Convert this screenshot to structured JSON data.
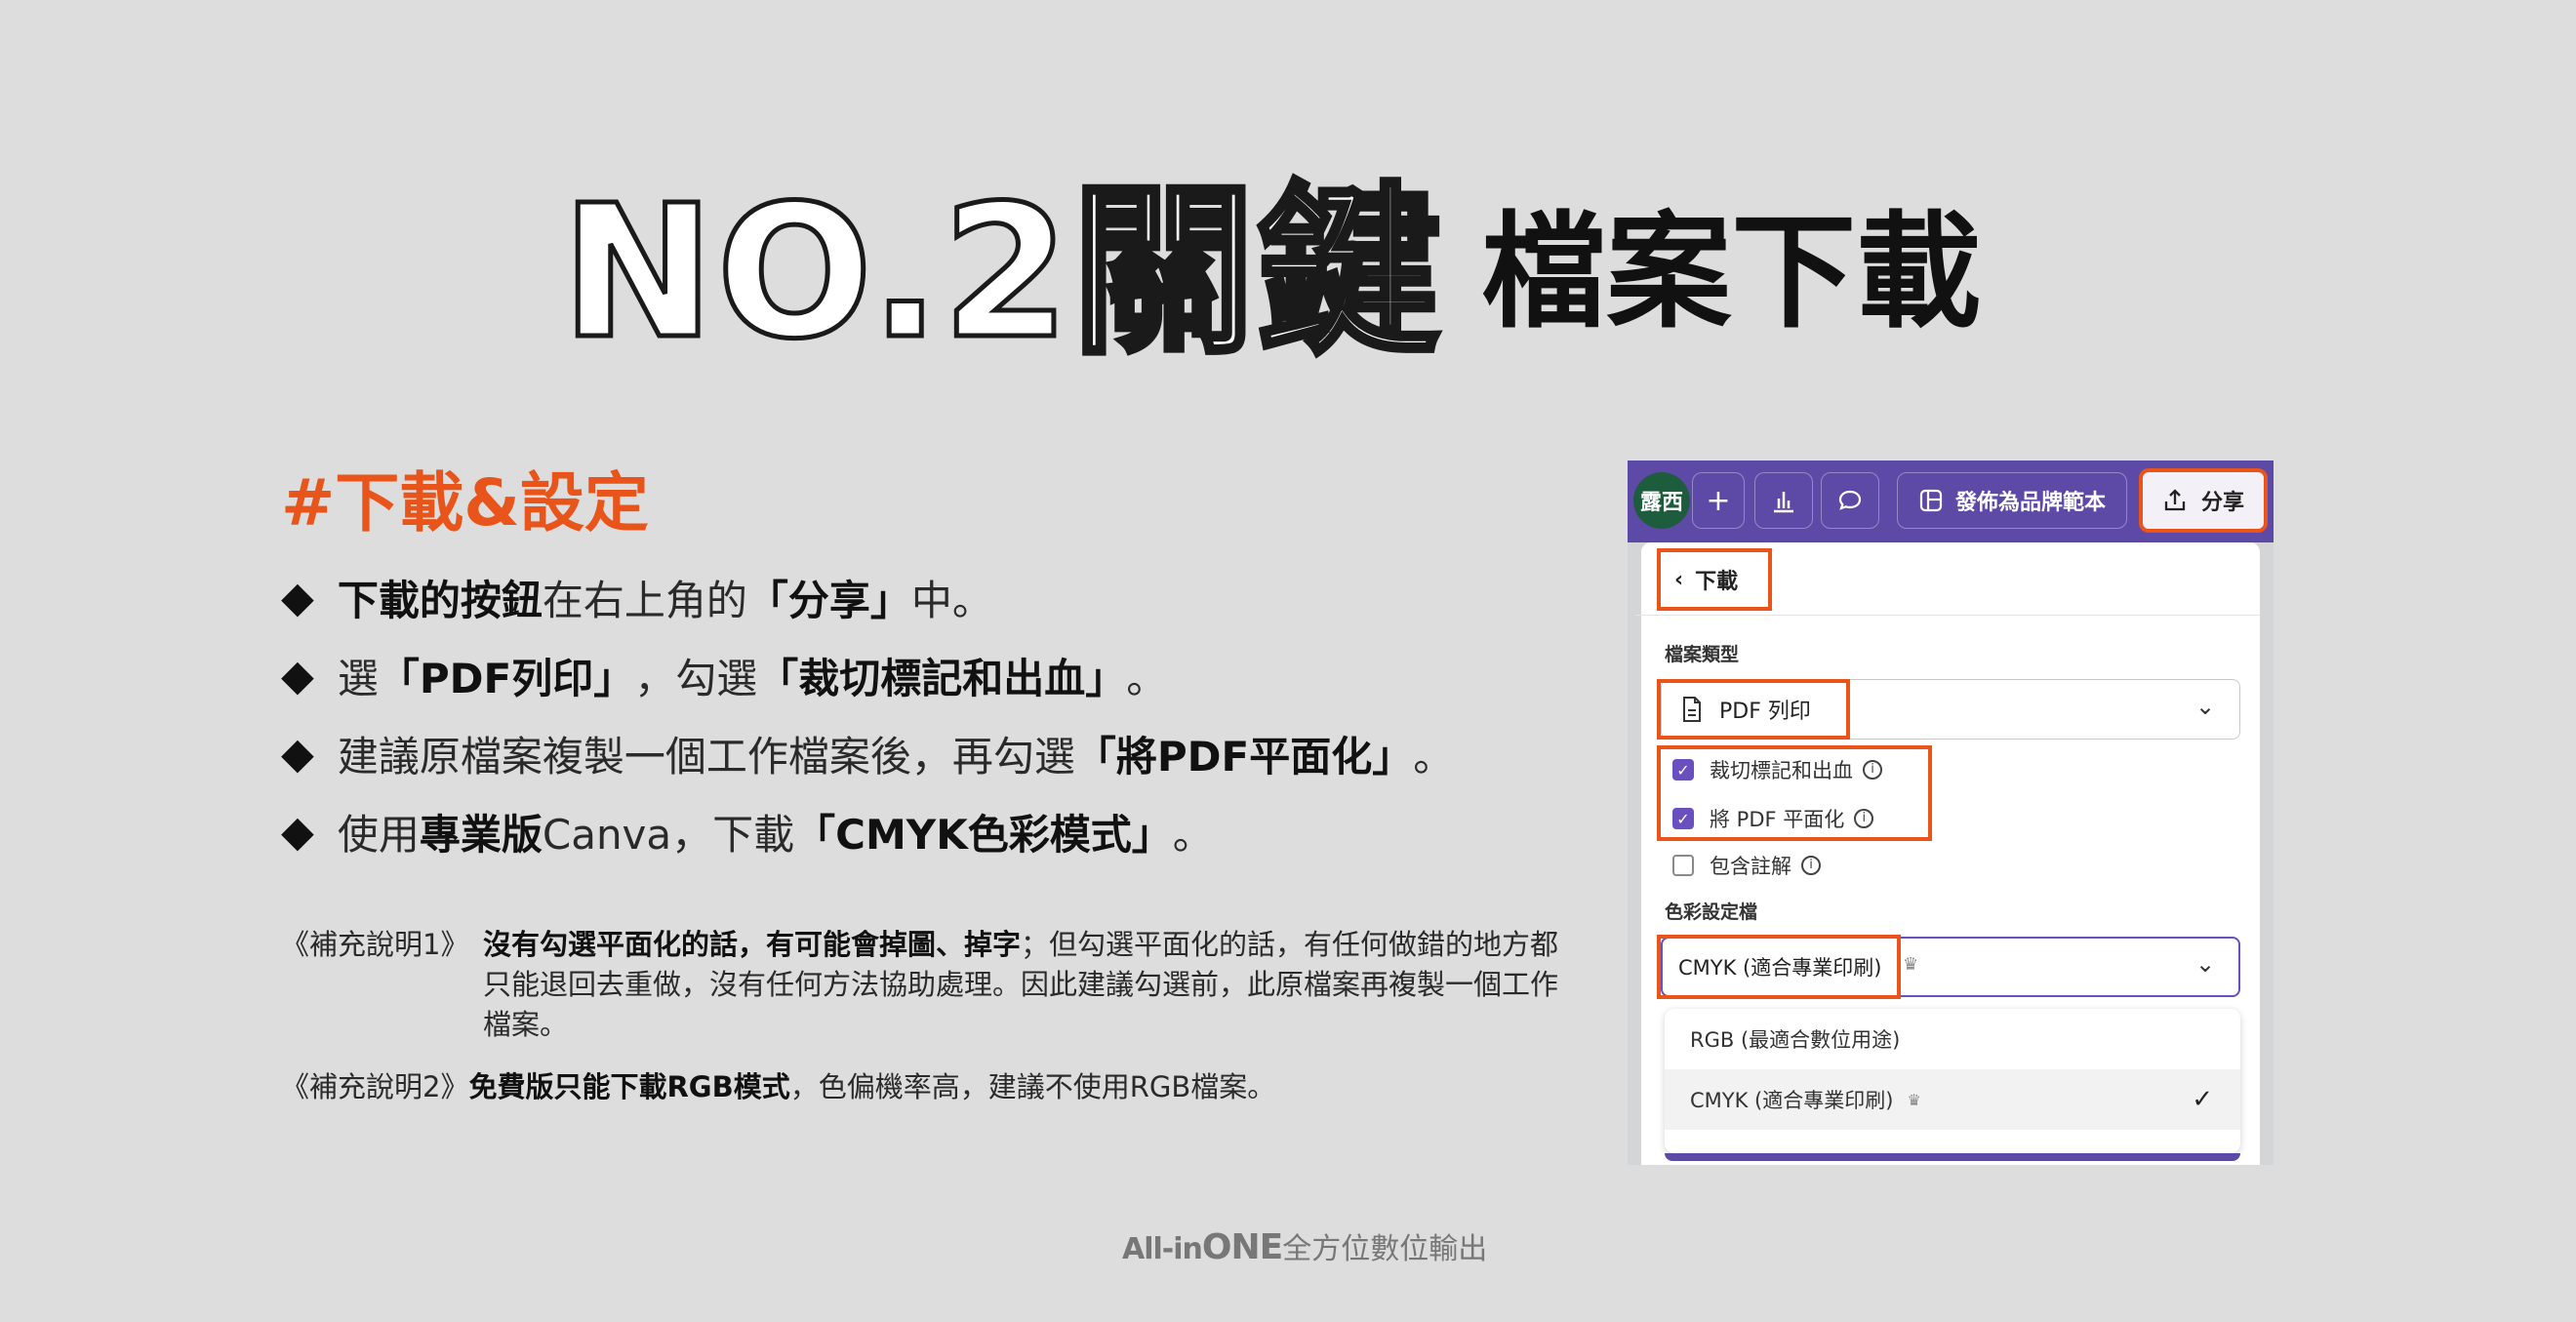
{
  "title": {
    "outline": "NO.2關鍵",
    "solid": "檔案下載"
  },
  "section": {
    "hashtag": "#下載&設定"
  },
  "bullets": {
    "b1": {
      "bold1": "下載的按鈕",
      "t1": "在右上角的",
      "bold2": "「分享」",
      "t2": "中。"
    },
    "b2": {
      "t1": "選",
      "bold1": "「PDF列印」",
      "t2": "，勾選",
      "bold2": "「裁切標記和出血」",
      "t3": "。"
    },
    "b3": {
      "t1": "建議原檔案複製一個工作檔案後，再勾選",
      "bold1": "「將PDF平面化」",
      "t2": "。"
    },
    "b4": {
      "t1": "使用",
      "bold1": "專業版",
      "t2": "Canva，下載",
      "bold2": "「CMYK色彩模式」",
      "t3": "。"
    }
  },
  "notes": {
    "n1_label": "《補充說明1》",
    "n1_bold": "沒有勾選平面化的話，有可能會掉圖、掉字",
    "n1_text": "；但勾選平面化的話，有任何做錯的地方都只能退回去重做，沒有任何方法協助處理。因此建議勾選前，此原檔案再複製一個工作檔案。",
    "n2_label": "《補充說明2》",
    "n2_bold": "免費版只能下載RGB模式",
    "n2_text": "，色偏機率高，建議不使用RGB檔案。"
  },
  "footer": {
    "brand_prefix": "All-in",
    "brand_one": "ONE",
    "brand_suffix": "全方位數位輸出"
  },
  "canva": {
    "avatar": "露西",
    "plus_icon": "+",
    "publish_label": "發佈為品牌範本",
    "share_label": "分享",
    "back_label": "下載",
    "file_type_label": "檔案類型",
    "file_type_value": "PDF 列印",
    "checkboxes": [
      {
        "label": "裁切標記和出血",
        "checked": true
      },
      {
        "label": "將 PDF 平面化",
        "checked": true
      },
      {
        "label": "包含註解",
        "checked": false
      }
    ],
    "color_profile_label": "色彩設定檔",
    "color_profile_value": "CMYK (適合專業印刷)",
    "options": [
      {
        "label": "RGB (最適合數位用途)"
      },
      {
        "label": "CMYK (適合專業印刷)"
      }
    ],
    "accent_color": "#5d4aa6",
    "highlight_color": "#e8541a"
  }
}
